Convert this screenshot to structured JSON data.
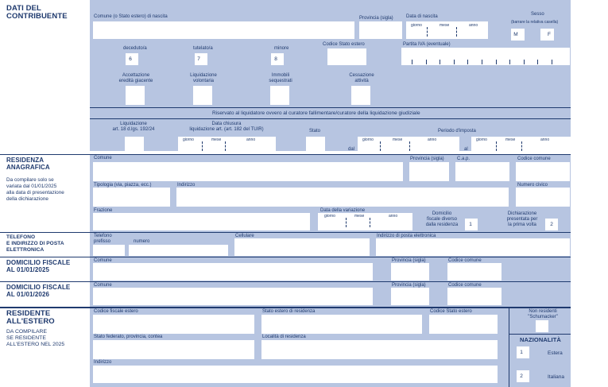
{
  "contribuente": {
    "title_line1": "DATI DEL",
    "title_line2": "CONTRIBUENTE",
    "comune_nascita": "Comune (o Stato estero) di nascita",
    "provincia": "Provincia (sigla)",
    "data_nascita": "Data di nascita",
    "giorno": "giorno",
    "mese": "mese",
    "anno": "anno",
    "sesso": "Sesso",
    "sesso_hint": "(barrare la relativa casella)",
    "sesso_m": "M",
    "sesso_f": "F",
    "deceduto": "deceduto/a",
    "deceduto_code": "6",
    "tutelato": "tutelato/a",
    "tutelato_code": "7",
    "minore": "minore",
    "minore_code": "8",
    "codice_stato_estero": "Codice Stato estero",
    "partita_iva": "Partita IVA (eventuale)",
    "accettazione": "Accettazione",
    "eredita": "eredità giacente",
    "liquidazione": "Liquidazione",
    "volontaria": "volontaria",
    "immobili": "Immobili",
    "sequestrati": "sequestrati",
    "cessazione": "Cessazione",
    "attivita": "attività"
  },
  "liquidatore": {
    "header": "Riservato al liquidatore ovvero al curatore fallimentare/curatore della liquidazione giudiziale",
    "liquidazione": "Liquidazione",
    "art18": "art. 18 d.lgs. 192/24",
    "data_chiusura": "Data chiusura",
    "liquidazione_art": "liquidazione art. (art. 182 del TUIR)",
    "stato": "Stato",
    "periodo": "Periodo d'imposta",
    "dal": "dal",
    "al": "al"
  },
  "residenza": {
    "title_line1": "RESIDENZA",
    "title_line2": "ANAGRAFICA",
    "note_line1": "Da compilare solo se",
    "note_line2": "variata dal 01/01/2025",
    "note_line3": "alla data di presentazione",
    "note_line4": "della dichiarazione",
    "comune": "Comune",
    "provincia": "Provincia (sigla)",
    "cap": "C.a.p.",
    "codice_comune": "Codice comune",
    "tipologia": "Tipologia (via, piazza, ecc.)",
    "indirizzo": "Indirizzo",
    "numero_civico": "Numero civico",
    "frazione": "Frazione",
    "data_variazione": "Data della variazione",
    "domicilio_line1": "Domicilio",
    "domicilio_line2": "fiscale diverso",
    "domicilio_line3": "dalla residenza",
    "domicilio_code": "1",
    "dichiarazione_line1": "Dichiarazione",
    "dichiarazione_line2": "presentata per",
    "dichiarazione_line3": "la prima volta",
    "dichiarazione_code": "2"
  },
  "telefono": {
    "title_line1": "TELEFONO",
    "title_line2": "E INDIRIZZO DI POSTA",
    "title_line3": "ELETTRONICA",
    "telefono": "Telefono",
    "prefisso": "prefisso",
    "numero": "numero",
    "cellulare": "Cellulare",
    "email": "Indirizzo di posta elettronica"
  },
  "domicilio_2025": {
    "title_line1": "DOMICILIO FISCALE",
    "title_line2": "AL 01/01/2025",
    "comune": "Comune",
    "provincia": "Provincia (sigla)",
    "codice_comune": "Codice comune"
  },
  "domicilio_2026": {
    "title_line1": "DOMICILIO FISCALE",
    "title_line2": "AL 01/01/2026",
    "comune": "Comune",
    "provincia": "Provincia (sigla)",
    "codice_comune": "Codice comune"
  },
  "estero": {
    "title_line1": "RESIDENTE",
    "title_line2": "ALL'ESTERO",
    "note_line1": "DA COMPILARE",
    "note_line2": "SE RESIDENTE",
    "note_line3": "ALL'ESTERO NEL 2025",
    "codice_fiscale_estero": "Codice fiscale estero",
    "stato_estero": "Stato estero di residenza",
    "codice_stato": "Codice Stato estero",
    "non_residenti_line1": "Non residenti",
    "non_residenti_line2": "\"Schumacker\"",
    "stato_federato": "Stato federato, provincia, contea",
    "localita": "Località di residenza",
    "indirizzo": "Indirizzo",
    "nazionalita": "NAZIONALITÀ",
    "estera_code": "1",
    "estera": "Estera",
    "italiana_code": "2",
    "italiana": "Italiana"
  },
  "colors": {
    "panel": "#b7c5e1",
    "ink": "#1f3a6e",
    "field": "#ffffff"
  }
}
